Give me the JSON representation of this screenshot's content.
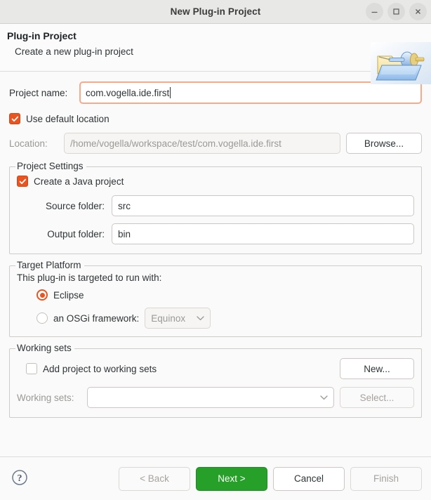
{
  "window": {
    "title": "New Plug-in Project",
    "buttons": [
      {
        "name": "minimize",
        "glyph": "minimize-icon"
      },
      {
        "name": "maximize",
        "glyph": "maximize-icon"
      },
      {
        "name": "close",
        "glyph": "close-icon"
      }
    ]
  },
  "header": {
    "title": "Plug-in Project",
    "subtitle": "Create a new plug-in project",
    "icon": "plugin-project-folder-icon"
  },
  "project_name": {
    "label": "Project name:",
    "value": "com.vogella.ide.first",
    "focused": true
  },
  "location": {
    "use_default_label": "Use default location",
    "use_default_checked": true,
    "label": "Location:",
    "value": "/home/vogella/workspace/test/com.vogella.ide.first",
    "enabled": false,
    "browse_label": "Browse..."
  },
  "project_settings": {
    "group_title": "Project Settings",
    "create_java_label": "Create a Java project",
    "create_java_checked": true,
    "source_folder": {
      "label": "Source folder:",
      "value": "src"
    },
    "output_folder": {
      "label": "Output folder:",
      "value": "bin"
    }
  },
  "target_platform": {
    "group_title": "Target Platform",
    "description": "This plug-in is targeted to run with:",
    "options": [
      {
        "label": "Eclipse",
        "selected": true
      },
      {
        "label": "an OSGi framework:",
        "selected": false
      }
    ],
    "framework_combo": {
      "value": "Equinox",
      "enabled": false
    }
  },
  "working_sets": {
    "group_title": "Working sets",
    "add_label": "Add project to working sets",
    "add_checked": false,
    "new_label": "New...",
    "sets_label": "Working sets:",
    "sets_value": "",
    "select_label": "Select...",
    "enabled": false
  },
  "footer": {
    "help_icon": "help-question-icon",
    "back_label": "< Back",
    "back_enabled": false,
    "next_label": "Next >",
    "next_enabled": true,
    "cancel_label": "Cancel",
    "cancel_enabled": true,
    "finish_label": "Finish",
    "finish_enabled": false
  },
  "colors": {
    "accent": "#e95420",
    "primary_button": "#26a028",
    "focus_border": "#f7a98a"
  }
}
